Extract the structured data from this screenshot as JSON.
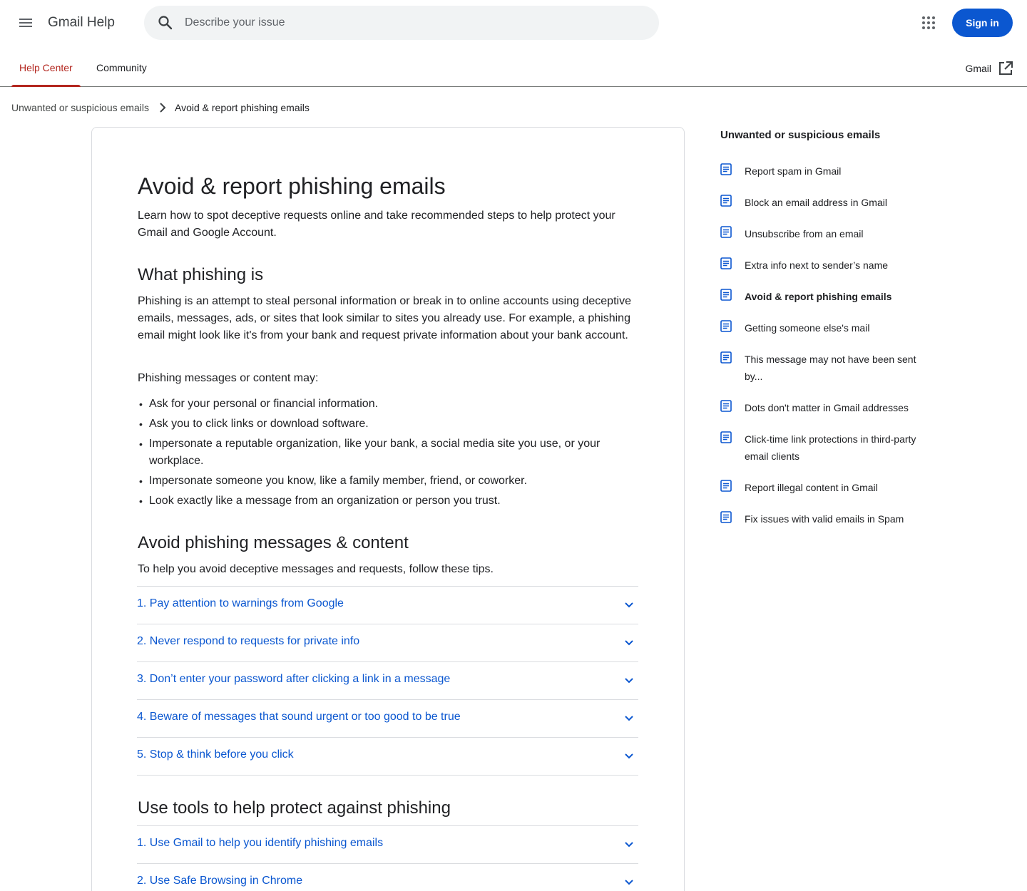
{
  "header": {
    "app_title": "Gmail Help",
    "search_placeholder": "Describe your issue",
    "signin_label": "Sign in"
  },
  "tabs": {
    "help_center": "Help Center",
    "community": "Community",
    "gmail_link": "Gmail"
  },
  "breadcrumb": {
    "parent": "Unwanted or suspicious emails",
    "current": "Avoid & report phishing emails"
  },
  "article": {
    "title": "Avoid & report phishing emails",
    "intro": "Learn how to spot deceptive requests online and take recommended steps to help protect your Gmail and Google Account.",
    "section1_title": "What phishing is",
    "section1_p1": "Phishing is an attempt to steal personal information or break in to online accounts using deceptive emails, messages, ads, or sites that look similar to sites you already use. For example, a phishing email might look like it's from your bank and request private information about your bank account.",
    "section1_p2": "Phishing messages or content may:",
    "bullets": [
      "Ask for your personal or financial information.",
      "Ask you to click links or download software.",
      "Impersonate a reputable organization, like your bank, a social media site you use, or your workplace.",
      "Impersonate someone you know, like a family member, friend, or coworker.",
      "Look exactly like a message from an organization or person you trust."
    ],
    "section2_title": "Avoid phishing messages & content",
    "section2_p": "To help you avoid deceptive messages and requests, follow these tips.",
    "tips": [
      "1. Pay attention to warnings from Google",
      "2. Never respond to requests for private info",
      "3. Don’t enter your password after clicking a link in a message",
      "4. Beware of messages that sound urgent or too good to be true",
      "5. Stop & think before you click"
    ],
    "section3_title": "Use tools to help protect against phishing",
    "tools": [
      "1. Use Gmail to help you identify phishing emails",
      "2. Use Safe Browsing in Chrome"
    ]
  },
  "sidebar": {
    "title": "Unwanted or suspicious emails",
    "items": [
      "Report spam in Gmail",
      "Block an email address in Gmail",
      "Unsubscribe from an email",
      "Extra info next to sender’s name",
      "Avoid & report phishing emails",
      "Getting someone else's mail",
      "This message may not have been sent by...",
      "Dots don't matter in Gmail addresses",
      "Click-time link protections in third-party email clients",
      "Report illegal content in Gmail",
      "Fix issues with valid emails in Spam"
    ]
  },
  "colors": {
    "link": "#0b57d0",
    "active_tab": "#b3261e",
    "button": "#0b57d0"
  }
}
